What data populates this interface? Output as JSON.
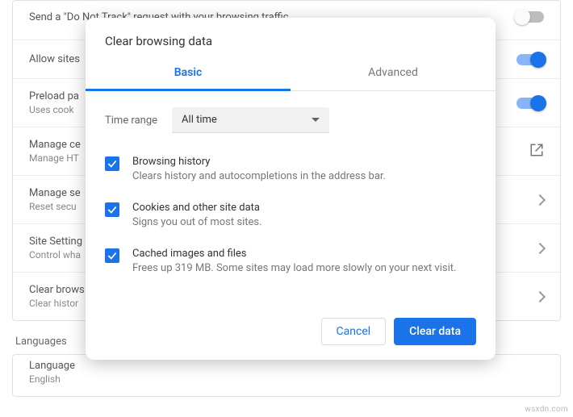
{
  "settings": {
    "doNotTrack": {
      "title": "Send a \"Do Not Track\" request with your browsing traffic"
    },
    "allowSites": {
      "title": "Allow sites"
    },
    "preload": {
      "title": "Preload pa",
      "sub": "Uses cook"
    },
    "manageCerts": {
      "title": "Manage ce",
      "sub": "Manage HT"
    },
    "manageSecurity": {
      "title": "Manage se",
      "sub": "Reset secu"
    },
    "siteSettings": {
      "title": "Site Setting",
      "sub": "Control wha"
    },
    "clearBrowsing": {
      "title": "Clear brows",
      "sub": "Clear histor"
    }
  },
  "sections": {
    "languages": "Languages"
  },
  "languageRow": {
    "title": "Language",
    "sub": "English"
  },
  "modal": {
    "title": "Clear browsing data",
    "tabs": {
      "basic": "Basic",
      "advanced": "Advanced"
    },
    "timeRange": {
      "label": "Time range",
      "value": "All time"
    },
    "items": {
      "history": {
        "title": "Browsing history",
        "sub": "Clears history and autocompletions in the address bar."
      },
      "cookies": {
        "title": "Cookies and other site data",
        "sub": "Signs you out of most sites."
      },
      "cache": {
        "title": "Cached images and files",
        "sub": "Frees up 319 MB. Some sites may load more slowly on your next visit."
      }
    },
    "buttons": {
      "cancel": "Cancel",
      "clear": "Clear data"
    }
  },
  "watermark": "wsxdn.com"
}
